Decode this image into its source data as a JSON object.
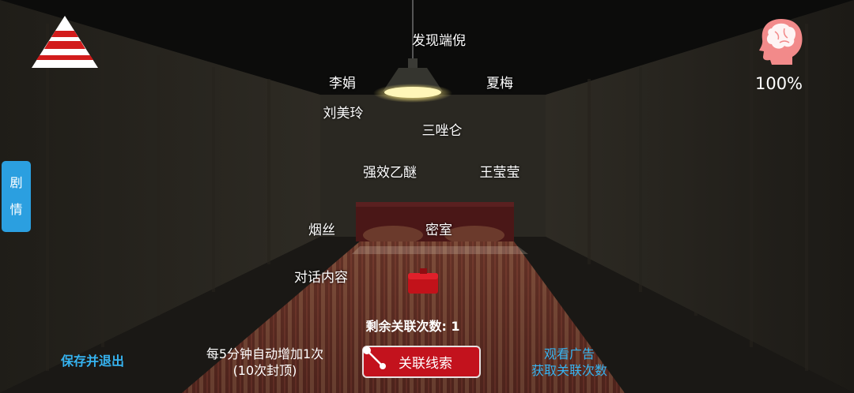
{
  "clues": [
    {
      "id": "discover",
      "text": "发现端倪"
    },
    {
      "id": "li-juan",
      "text": "李娟"
    },
    {
      "id": "xia-mei",
      "text": "夏梅"
    },
    {
      "id": "liu-meiling",
      "text": "刘美玲"
    },
    {
      "id": "triazolam",
      "text": "三唑仑"
    },
    {
      "id": "ether",
      "text": "强效乙醚"
    },
    {
      "id": "wang-yingying",
      "text": "王莹莹"
    },
    {
      "id": "tobacco",
      "text": "烟丝"
    },
    {
      "id": "secret-room",
      "text": "密室"
    },
    {
      "id": "dialogue",
      "text": "对话内容"
    }
  ],
  "story_tab": {
    "char1": "剧",
    "char2": "情"
  },
  "remaining": "剩余关联次数: 1",
  "link_button": "关联线索",
  "save_exit": "保存并退出",
  "auto_info": {
    "line1": "每5分钟自动增加1次",
    "line2": "(10次封顶)"
  },
  "ad": {
    "line1": "观看广告",
    "line2": "获取关联次数"
  },
  "sanity": "100%",
  "icons": {
    "menu": "pyramid-menu-icon",
    "sanity": "brain-head-icon"
  },
  "colors": {
    "accent_blue": "#2b9fe0",
    "button_red": "#c3121d",
    "brain_pink": "#f28a8a"
  }
}
